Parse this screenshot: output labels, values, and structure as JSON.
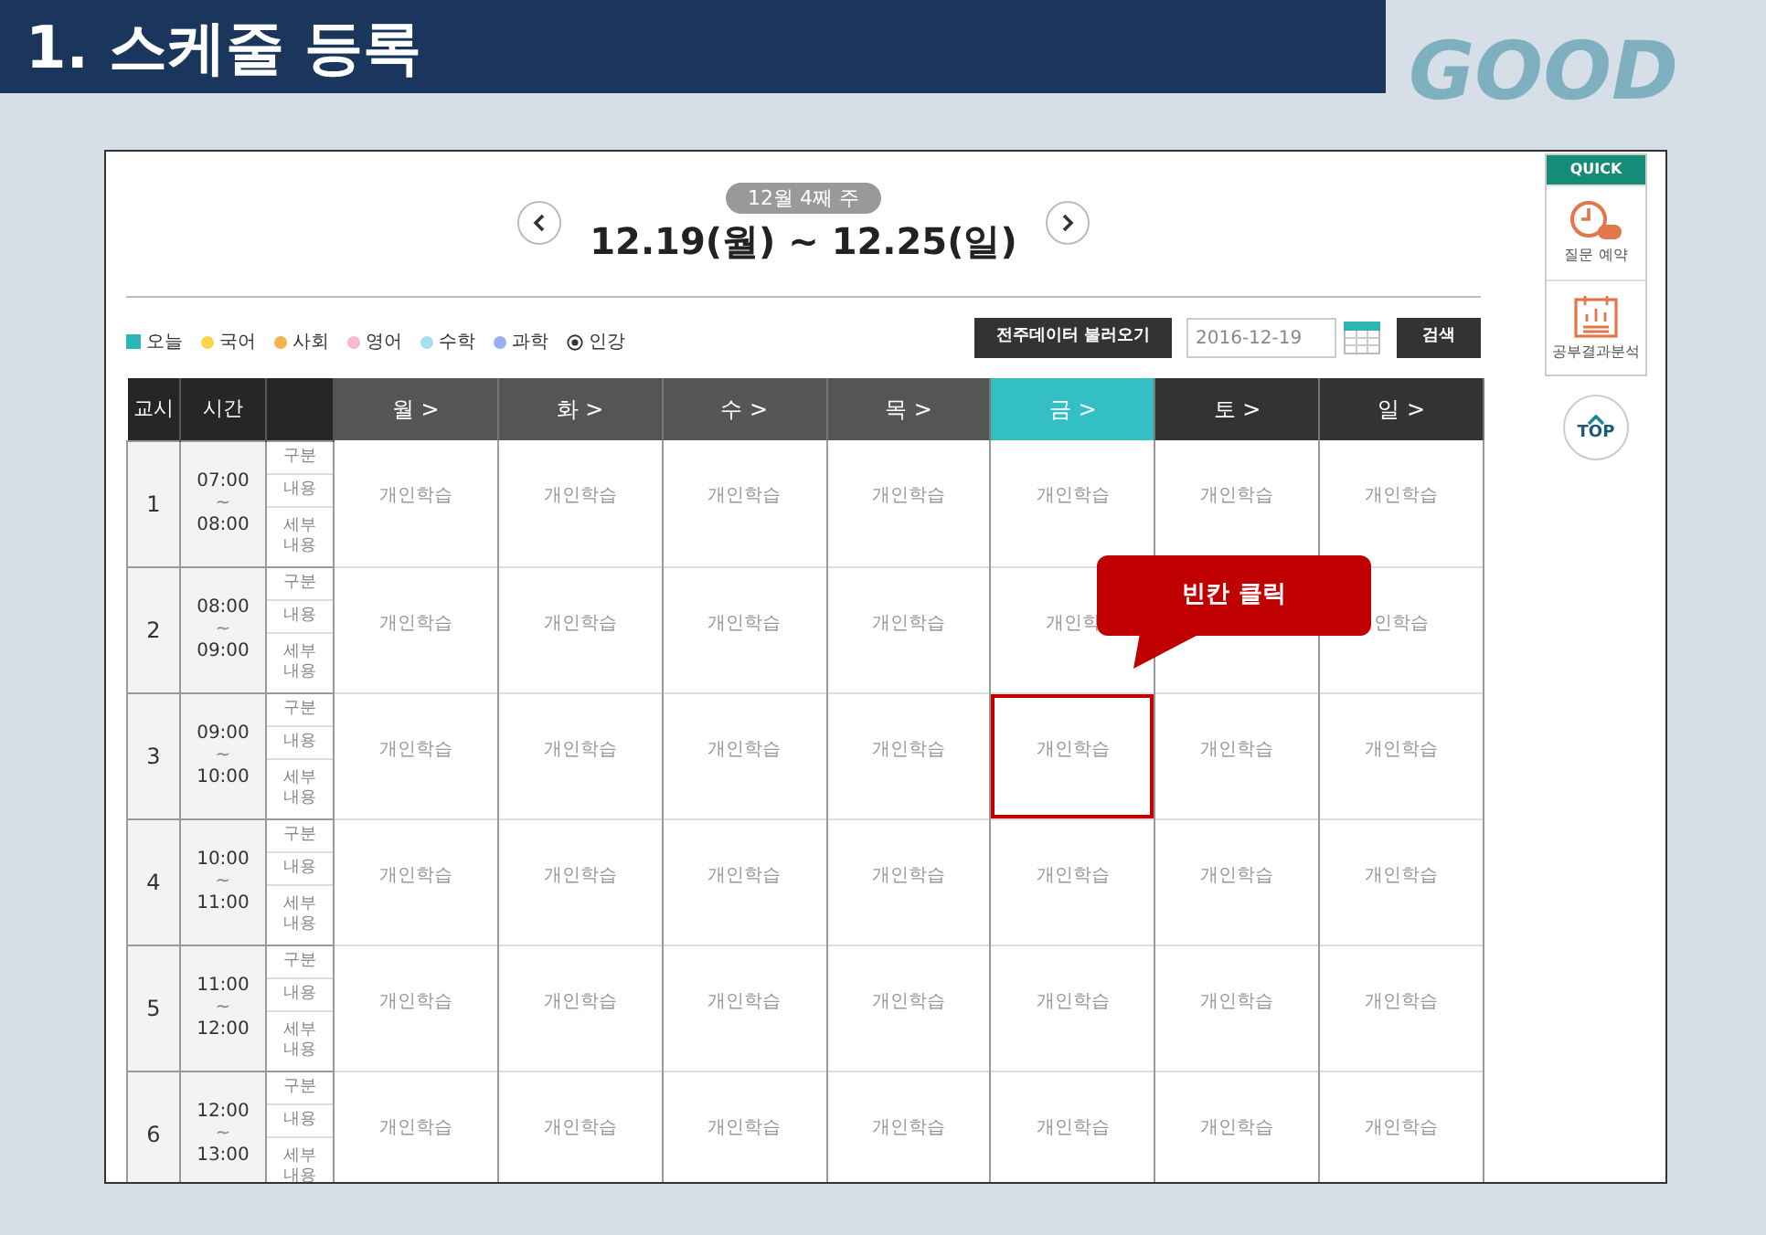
{
  "slide": {
    "title": "1. 스케줄 등록",
    "decoration": [
      "GOOD"
    ]
  },
  "week": {
    "badge": "12월 4째 주",
    "range": "12.19(월) ~ 12.25(일)"
  },
  "legend": [
    {
      "kind": "square",
      "label": "오늘",
      "color": "#2bb5b5"
    },
    {
      "kind": "dot",
      "label": "국어",
      "color": "#f7d64a"
    },
    {
      "kind": "dot",
      "label": "사회",
      "color": "#f5b350"
    },
    {
      "kind": "dot",
      "label": "영어",
      "color": "#f7b8d0"
    },
    {
      "kind": "dot",
      "label": "수학",
      "color": "#a8dcf0"
    },
    {
      "kind": "dot",
      "label": "과학",
      "color": "#9aaef0"
    },
    {
      "kind": "radio",
      "label": "인강"
    }
  ],
  "toolbar": {
    "load_button": "전주데이터 불러오기",
    "date_value": "2016-12-19",
    "search_button": "검색"
  },
  "table": {
    "columns": [
      "교시",
      "시간"
    ],
    "days": [
      {
        "label": "월 >",
        "selected": false,
        "weekend": false
      },
      {
        "label": "화 >",
        "selected": false,
        "weekend": false
      },
      {
        "label": "수 >",
        "selected": false,
        "weekend": false
      },
      {
        "label": "목 >",
        "selected": false,
        "weekend": false
      },
      {
        "label": "금 >",
        "selected": true,
        "weekend": false
      },
      {
        "label": "토 >",
        "selected": false,
        "weekend": true
      },
      {
        "label": "일 >",
        "selected": false,
        "weekend": true
      }
    ],
    "rows": [
      {
        "period": "1",
        "start": "07:00",
        "sep": "~",
        "end": "08:00",
        "fields": [
          "구분",
          "내용",
          "세부\n내용"
        ],
        "cells": [
          {
            "text": "개인학습",
            "highlighted": false
          },
          {
            "text": "개인학습",
            "highlighted": false
          },
          {
            "text": "개인학습",
            "highlighted": false
          },
          {
            "text": "개인학습",
            "highlighted": false
          },
          {
            "text": "개인학습",
            "highlighted": false
          },
          {
            "text": "개인학습",
            "highlighted": false
          },
          {
            "text": "개인학습",
            "highlighted": false
          }
        ]
      },
      {
        "period": "2",
        "start": "08:00",
        "sep": "~",
        "end": "09:00",
        "fields": [
          "구분",
          "내용",
          "세부\n내용"
        ],
        "cells": [
          {
            "text": "개인학습",
            "highlighted": false
          },
          {
            "text": "개인학습",
            "highlighted": false
          },
          {
            "text": "개인학습",
            "highlighted": false
          },
          {
            "text": "개인학습",
            "highlighted": false
          },
          {
            "text": "개인학",
            "highlighted": false
          },
          {
            "text": "",
            "highlighted": false
          },
          {
            "text": "인학습",
            "highlighted": false
          }
        ]
      },
      {
        "period": "3",
        "start": "09:00",
        "sep": "~",
        "end": "10:00",
        "fields": [
          "구분",
          "내용",
          "세부\n내용"
        ],
        "cells": [
          {
            "text": "개인학습",
            "highlighted": false
          },
          {
            "text": "개인학습",
            "highlighted": false
          },
          {
            "text": "개인학습",
            "highlighted": false
          },
          {
            "text": "개인학습",
            "highlighted": false
          },
          {
            "text": "개인학습",
            "highlighted": true
          },
          {
            "text": "개인학습",
            "highlighted": false
          },
          {
            "text": "개인학습",
            "highlighted": false
          }
        ]
      },
      {
        "period": "4",
        "start": "10:00",
        "sep": "~",
        "end": "11:00",
        "fields": [
          "구분",
          "내용",
          "세부\n내용"
        ],
        "cells": [
          {
            "text": "개인학습",
            "highlighted": false
          },
          {
            "text": "개인학습",
            "highlighted": false
          },
          {
            "text": "개인학습",
            "highlighted": false
          },
          {
            "text": "개인학습",
            "highlighted": false
          },
          {
            "text": "개인학습",
            "highlighted": false
          },
          {
            "text": "개인학습",
            "highlighted": false
          },
          {
            "text": "개인학습",
            "highlighted": false
          }
        ]
      },
      {
        "period": "5",
        "start": "11:00",
        "sep": "~",
        "end": "12:00",
        "fields": [
          "구분",
          "내용",
          "세부\n내용"
        ],
        "cells": [
          {
            "text": "개인학습",
            "highlighted": false
          },
          {
            "text": "개인학습",
            "highlighted": false
          },
          {
            "text": "개인학습",
            "highlighted": false
          },
          {
            "text": "개인학습",
            "highlighted": false
          },
          {
            "text": "개인학습",
            "highlighted": false
          },
          {
            "text": "개인학습",
            "highlighted": false
          },
          {
            "text": "개인학습",
            "highlighted": false
          }
        ]
      },
      {
        "period": "6",
        "start": "12:00",
        "sep": "~",
        "end": "13:00",
        "fields": [
          "구분",
          "내용",
          "세부\n내용"
        ],
        "cells": [
          {
            "text": "개인학습",
            "highlighted": false
          },
          {
            "text": "개인학습",
            "highlighted": false
          },
          {
            "text": "개인학습",
            "highlighted": false
          },
          {
            "text": "개인학습",
            "highlighted": false
          },
          {
            "text": "개인학습",
            "highlighted": false
          },
          {
            "text": "개인학습",
            "highlighted": false
          },
          {
            "text": "개인학습",
            "highlighted": false
          }
        ]
      }
    ]
  },
  "callout": "빈칸 클릭",
  "quick": {
    "title": "QUICK",
    "items": [
      {
        "kind": "clock",
        "label": "질문 예약"
      },
      {
        "kind": "chart",
        "label": "공부결과분석"
      }
    ],
    "top_button": "TOP"
  }
}
